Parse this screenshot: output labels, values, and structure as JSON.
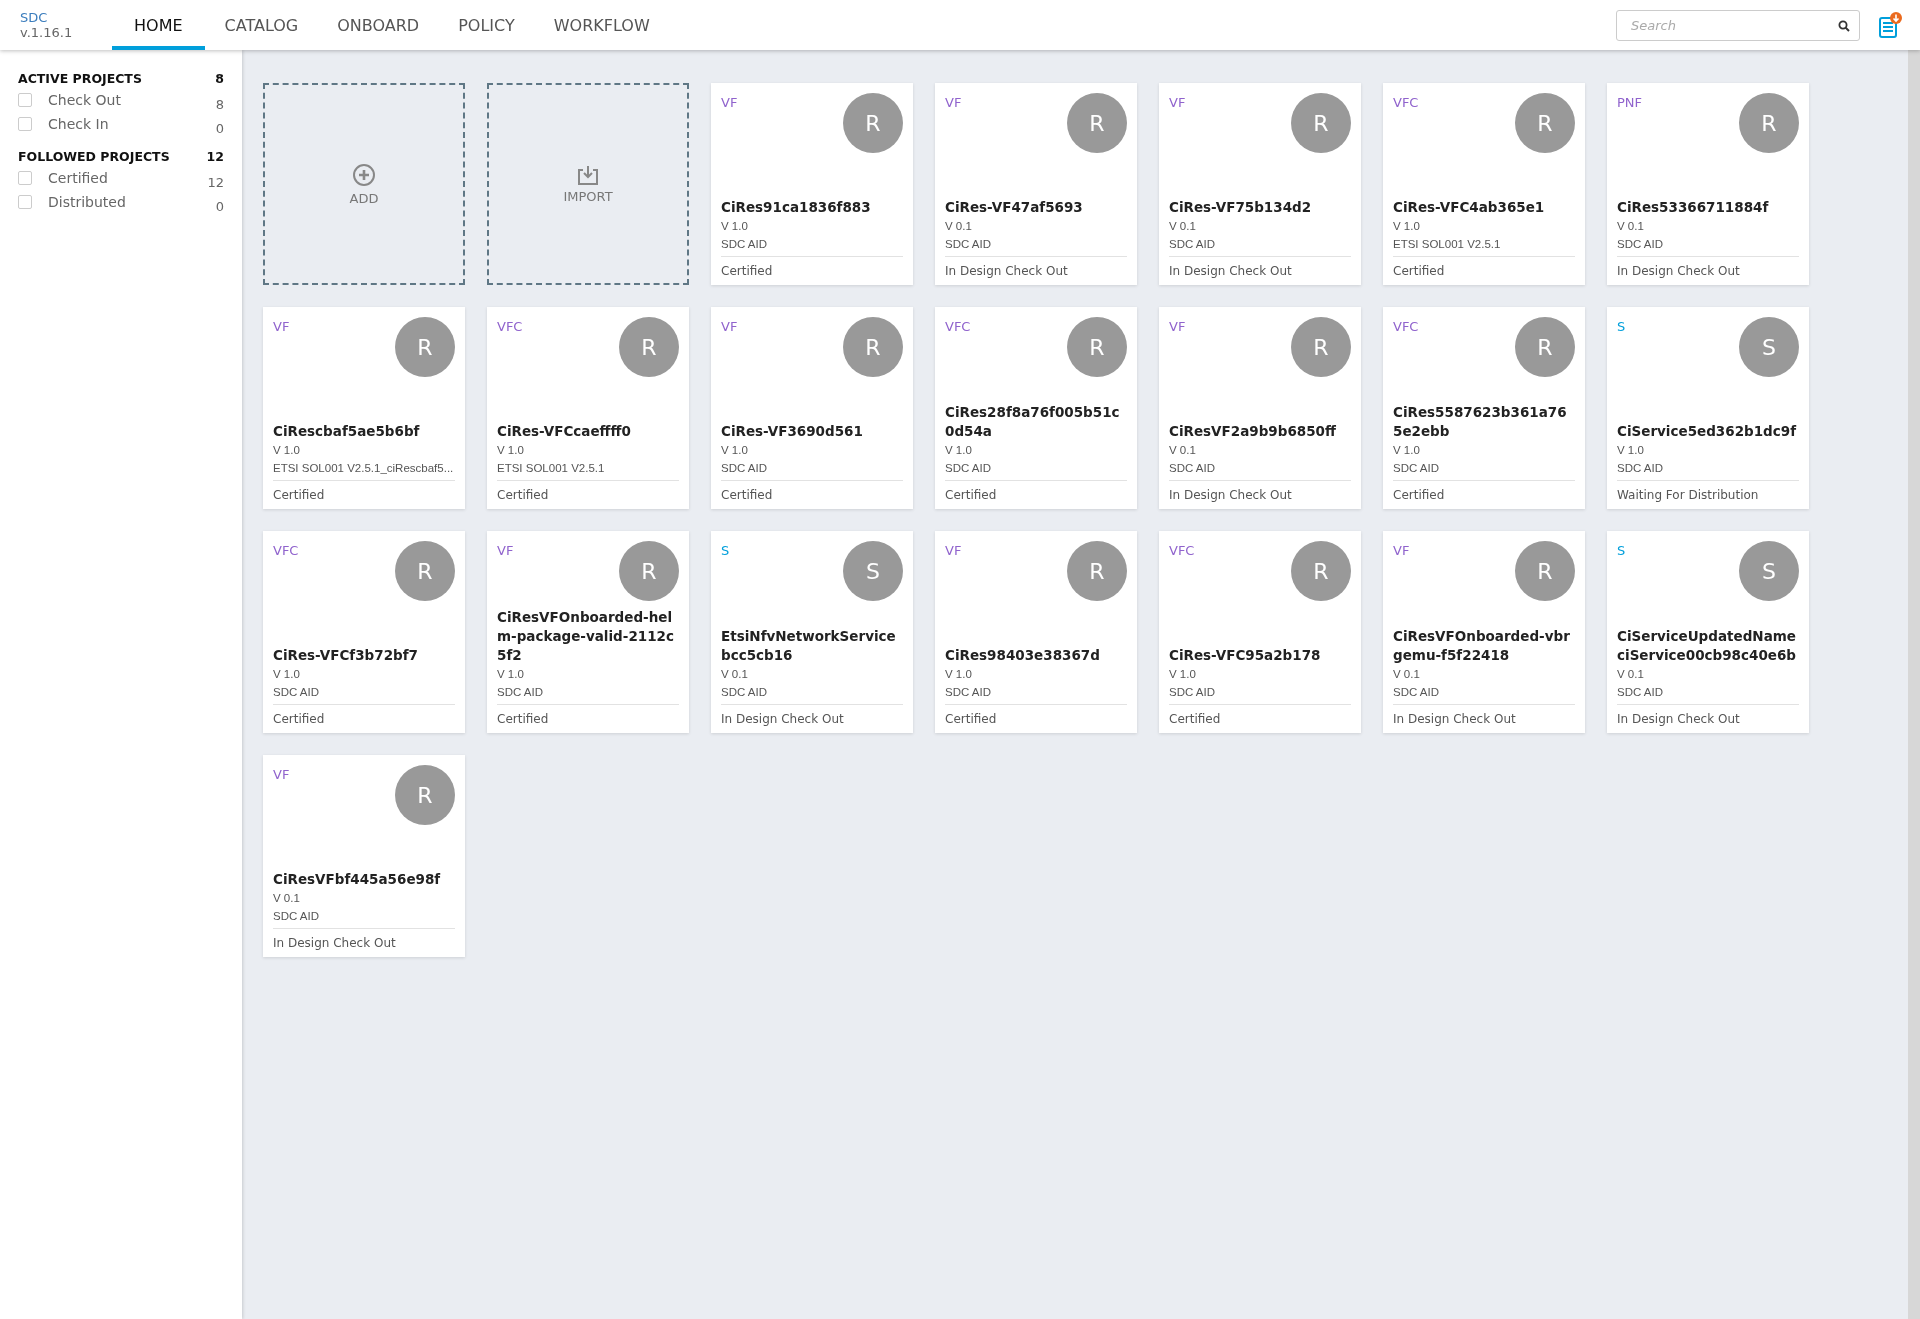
{
  "brand": {
    "name": "SDC",
    "version": "v.1.16.1"
  },
  "tabs": [
    {
      "label": "HOME",
      "selected": true
    },
    {
      "label": "CATALOG",
      "selected": false
    },
    {
      "label": "ONBOARD",
      "selected": false
    },
    {
      "label": "POLICY",
      "selected": false
    },
    {
      "label": "WORKFLOW",
      "selected": false
    }
  ],
  "search": {
    "placeholder": "Search"
  },
  "sidebar": {
    "groups": [
      {
        "title": "ACTIVE PROJECTS",
        "count": "8",
        "items": [
          {
            "label": "Check Out",
            "count": "8",
            "checked": false
          },
          {
            "label": "Check In",
            "count": "0",
            "checked": false
          }
        ]
      },
      {
        "title": "FOLLOWED PROJECTS",
        "count": "12",
        "items": [
          {
            "label": "Certified",
            "count": "12",
            "checked": false
          },
          {
            "label": "Distributed",
            "count": "0",
            "checked": false
          }
        ]
      }
    ]
  },
  "actions": [
    {
      "kind": "add",
      "label": "ADD"
    },
    {
      "kind": "import",
      "label": "IMPORT"
    }
  ],
  "cards": [
    {
      "type": "VF",
      "color": "#9063cd",
      "avatar": "R",
      "title": "CiRes91ca1836f883",
      "version": "V 1.0",
      "description": "SDC AID",
      "status": "Certified"
    },
    {
      "type": "VF",
      "color": "#9063cd",
      "avatar": "R",
      "title": "CiRes-VF47af5693",
      "version": "V 0.1",
      "description": "SDC AID",
      "status": "In Design Check Out"
    },
    {
      "type": "VF",
      "color": "#9063cd",
      "avatar": "R",
      "title": "CiRes-VF75b134d2",
      "version": "V 0.1",
      "description": "SDC AID",
      "status": "In Design Check Out"
    },
    {
      "type": "VFC",
      "color": "#9063cd",
      "avatar": "R",
      "title": "CiRes-VFC4ab365e1",
      "version": "V 1.0",
      "description": "ETSI SOL001 V2.5.1",
      "status": "Certified"
    },
    {
      "type": "PNF",
      "color": "#9063cd",
      "avatar": "R",
      "title": "CiRes53366711884f",
      "version": "V 0.1",
      "description": "SDC AID",
      "status": "In Design Check Out"
    },
    {
      "type": "VF",
      "color": "#9063cd",
      "avatar": "R",
      "title": "CiRescbaf5ae5b6bf",
      "version": "V 1.0",
      "description": "ETSI SOL001 V2.5.1_ciRescbaf5...",
      "status": "Certified"
    },
    {
      "type": "VFC",
      "color": "#9063cd",
      "avatar": "R",
      "title": "CiRes-VFCcaeffff0",
      "version": "V 1.0",
      "description": "ETSI SOL001 V2.5.1",
      "status": "Certified"
    },
    {
      "type": "VF",
      "color": "#9063cd",
      "avatar": "R",
      "title": "CiRes-VF3690d561",
      "version": "V 1.0",
      "description": "SDC AID",
      "status": "Certified"
    },
    {
      "type": "VFC",
      "color": "#9063cd",
      "avatar": "R",
      "title": "CiRes28f8a76f005b51c0d54a",
      "version": "V 1.0",
      "description": "SDC AID",
      "status": "Certified"
    },
    {
      "type": "VF",
      "color": "#9063cd",
      "avatar": "R",
      "title": "CiResVF2a9b9b6850ff",
      "version": "V 0.1",
      "description": "SDC AID",
      "status": "In Design Check Out"
    },
    {
      "type": "VFC",
      "color": "#9063cd",
      "avatar": "R",
      "title": "CiRes5587623b361a765e2ebb",
      "version": "V 1.0",
      "description": "SDC AID",
      "status": "Certified"
    },
    {
      "type": "S",
      "color": "#009fdb",
      "avatar": "S",
      "title": "CiService5ed362b1dc9f",
      "version": "V 1.0",
      "description": "SDC AID",
      "status": "Waiting For Distribution"
    },
    {
      "type": "VFC",
      "color": "#9063cd",
      "avatar": "R",
      "title": "CiRes-VFCf3b72bf7",
      "version": "V 1.0",
      "description": "SDC AID",
      "status": "Certified"
    },
    {
      "type": "VF",
      "color": "#9063cd",
      "avatar": "R",
      "title": "CiResVFOnboarded-helm-package-valid-2112c5f2",
      "version": "V 1.0",
      "description": "SDC AID",
      "status": "Certified"
    },
    {
      "type": "S",
      "color": "#009fdb",
      "avatar": "S",
      "title": "EtsiNfvNetworkServicebcc5cb16",
      "version": "V 0.1",
      "description": "SDC AID",
      "status": "In Design Check Out"
    },
    {
      "type": "VF",
      "color": "#9063cd",
      "avatar": "R",
      "title": "CiRes98403e38367d",
      "version": "V 1.0",
      "description": "SDC AID",
      "status": "Certified"
    },
    {
      "type": "VFC",
      "color": "#9063cd",
      "avatar": "R",
      "title": "CiRes-VFC95a2b178",
      "version": "V 1.0",
      "description": "SDC AID",
      "status": "Certified"
    },
    {
      "type": "VF",
      "color": "#9063cd",
      "avatar": "R",
      "title": "CiResVFOnboarded-vbrgemu-f5f22418",
      "version": "V 0.1",
      "description": "SDC AID",
      "status": "In Design Check Out"
    },
    {
      "type": "S",
      "color": "#009fdb",
      "avatar": "S",
      "title": "CiServiceUpdatedNameciService00cb98c40e6b",
      "version": "V 0.1",
      "description": "SDC AID",
      "status": "In Design Check Out"
    },
    {
      "type": "VF",
      "color": "#9063cd",
      "avatar": "R",
      "title": "CiResVFbf445a56e98f",
      "version": "V 0.1",
      "description": "SDC AID",
      "status": "In Design Check Out"
    }
  ]
}
